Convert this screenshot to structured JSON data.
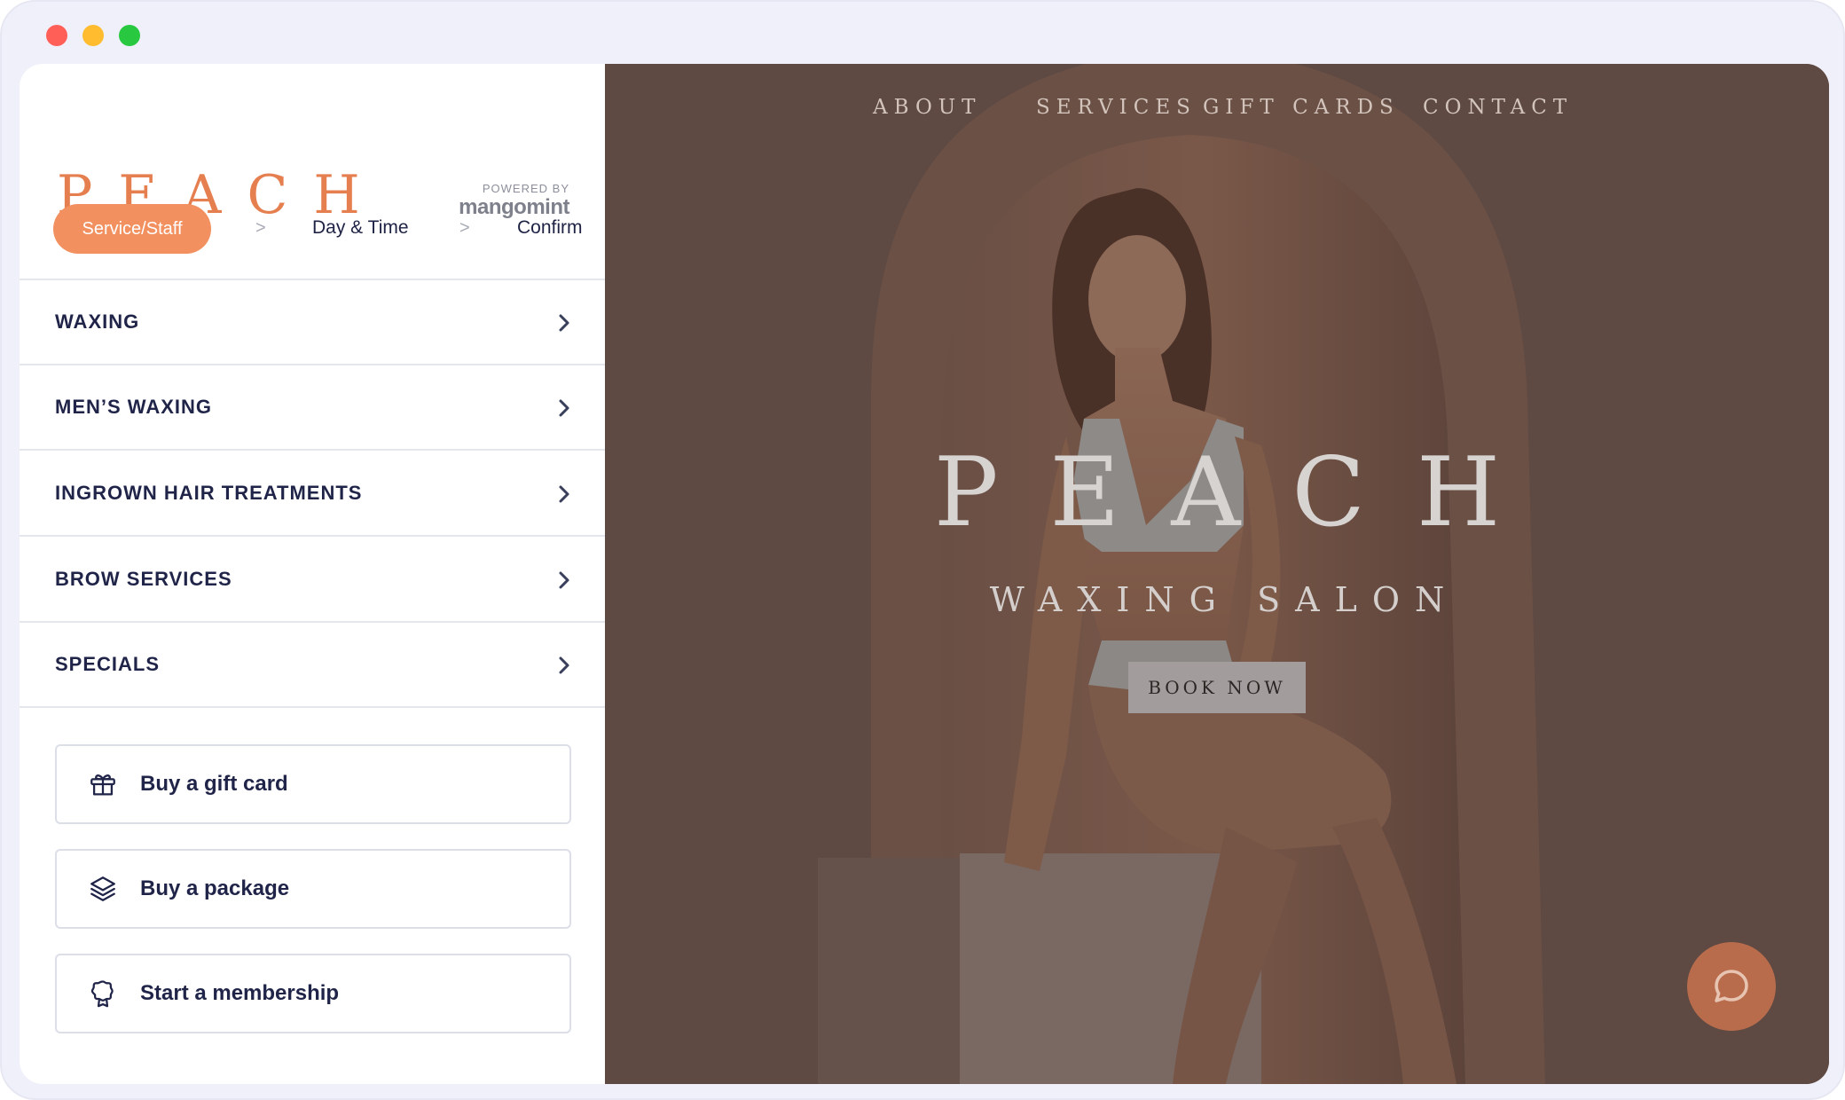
{
  "window": {
    "dot_colors": [
      "#ff5f57",
      "#febc2e",
      "#28c840"
    ]
  },
  "booking": {
    "brand": "PEACH",
    "powered_by": "POWERED BY",
    "powered_name": "mangomint",
    "steps": {
      "active": "Service/Staff",
      "separator": ">",
      "day_time": "Day & Time",
      "confirm": "Confirm"
    },
    "categories": [
      {
        "label": "WAXING"
      },
      {
        "label": "MEN’S WAXING"
      },
      {
        "label": "INGROWN HAIR TREATMENTS"
      },
      {
        "label": "BROW SERVICES"
      },
      {
        "label": "SPECIALS"
      }
    ],
    "actions": [
      {
        "label": "Buy a gift card",
        "icon": "gift-icon"
      },
      {
        "label": "Buy a package",
        "icon": "layers-icon"
      },
      {
        "label": "Start a membership",
        "icon": "award-icon"
      }
    ],
    "accent_color": "#f2905f",
    "text_color": "#1f2448"
  },
  "hero": {
    "nav": [
      "ABOUT",
      "SERVICES",
      "GIFT CARDS",
      "CONTACT"
    ],
    "title": "PEACH",
    "subtitle": "WAXING SALON",
    "cta": "BOOK NOW",
    "chat_icon": "chat-bubble-icon",
    "background_color": "#5e4a42"
  }
}
